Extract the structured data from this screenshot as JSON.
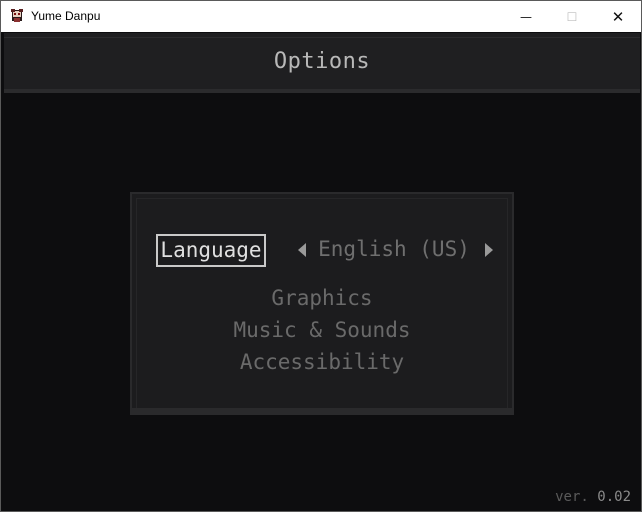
{
  "window": {
    "title": "Yume Danpu",
    "icon": "app-character-icon",
    "controls": {
      "minimize": "—",
      "maximize": "☐",
      "close": "✕"
    }
  },
  "header": {
    "title": "Options"
  },
  "menu": {
    "language": {
      "label": "Language",
      "value": "English (US)",
      "selected": true
    },
    "items": [
      {
        "label": "Graphics"
      },
      {
        "label": "Music & Sounds"
      },
      {
        "label": "Accessibility"
      }
    ]
  },
  "footer": {
    "version_prefix": "ver.",
    "version_number": "0.02"
  },
  "colors": {
    "background": "#0d0d0f",
    "panel": "#1c1c1e",
    "highlight": "#e0e0e0",
    "dim_text": "#6a6a6a"
  }
}
